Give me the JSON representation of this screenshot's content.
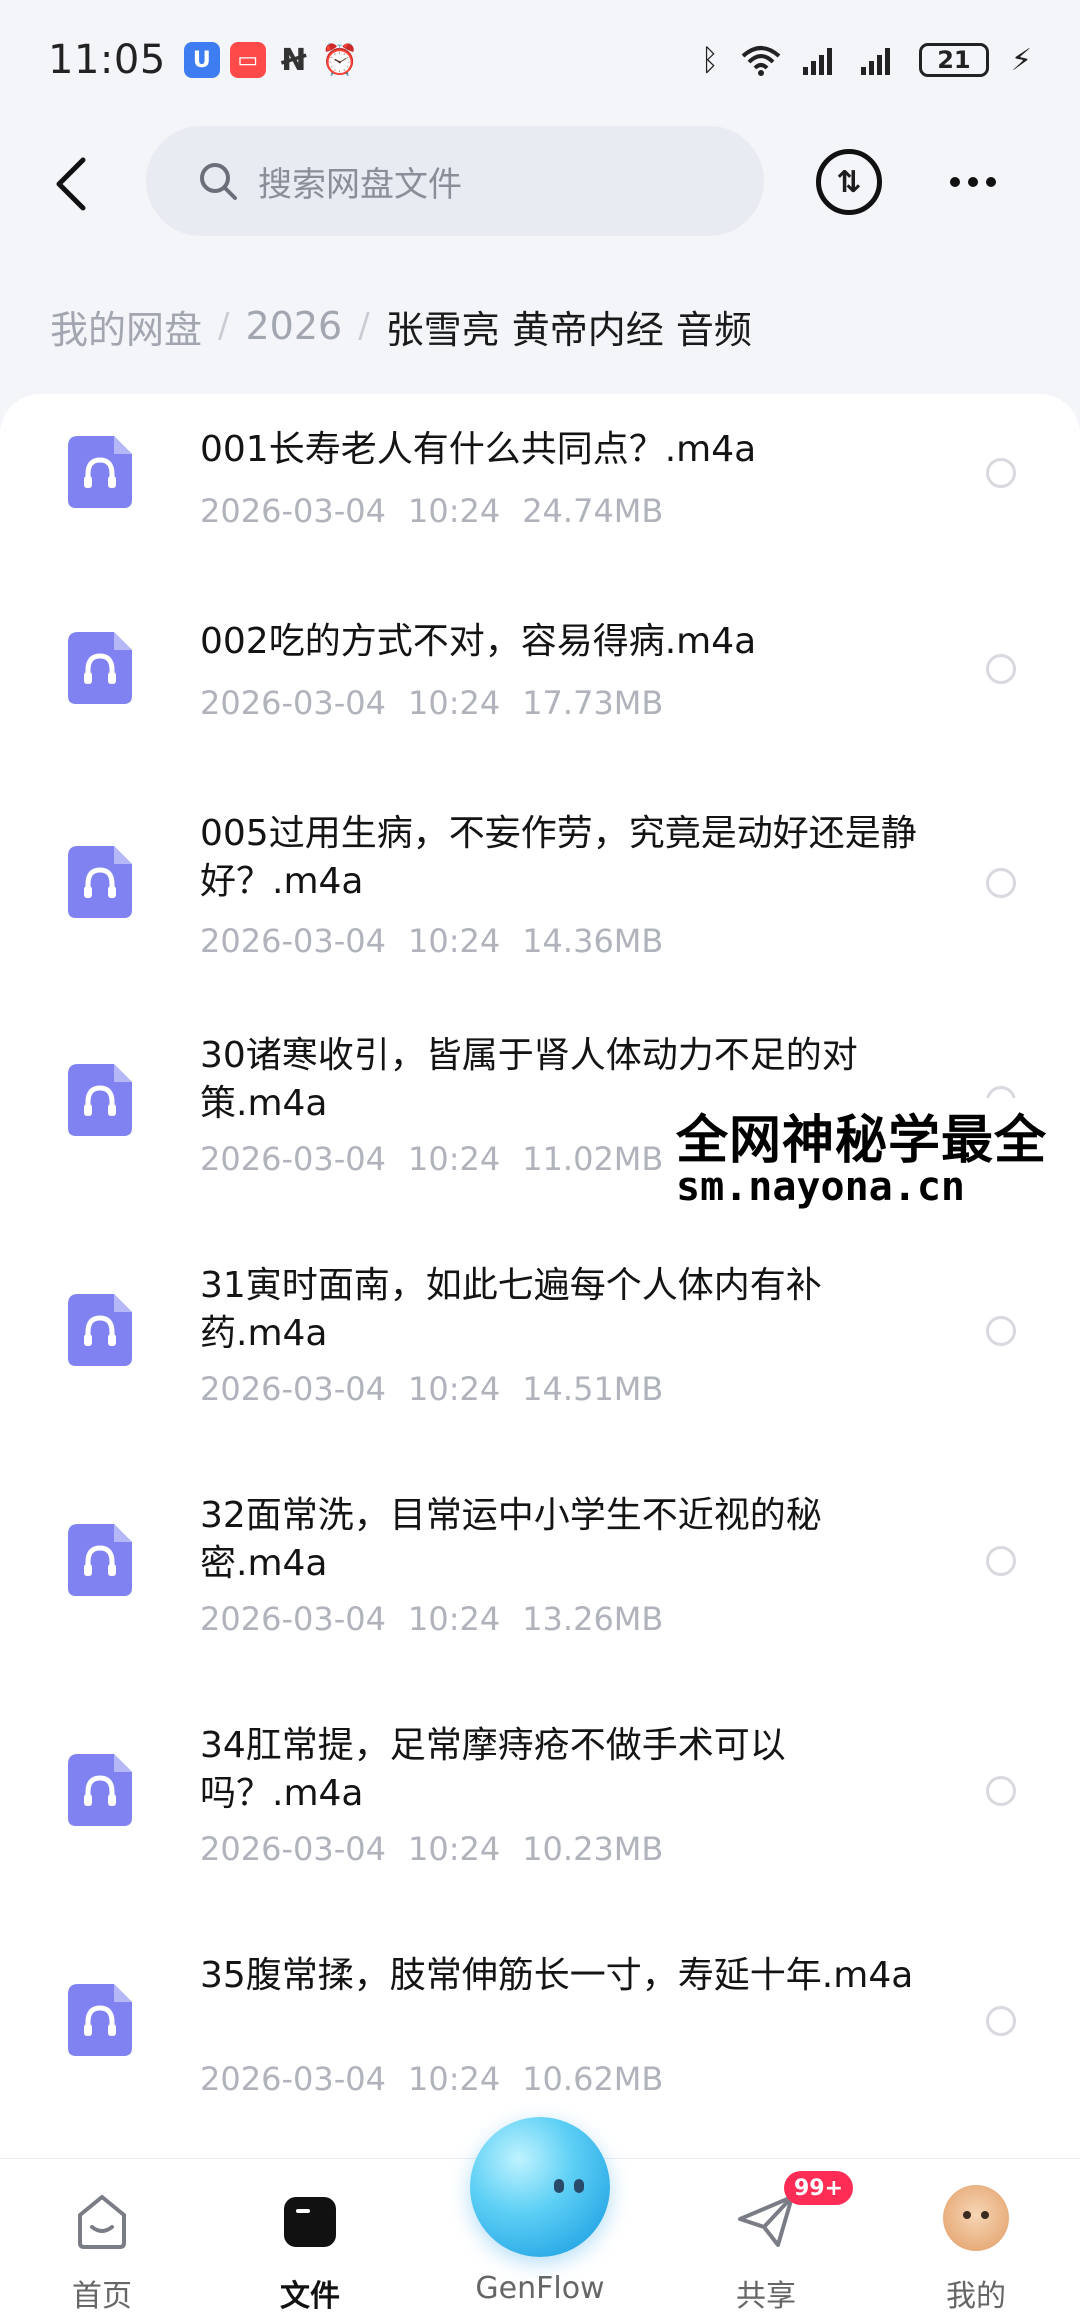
{
  "status_bar": {
    "time": "11:05",
    "battery": "21",
    "icons": [
      "app-icon-blue",
      "app-icon-red",
      "nfc-icon",
      "alarm-icon",
      "bluetooth-icon",
      "wifi-icon",
      "signal-icon",
      "signal-icon",
      "charging-icon"
    ]
  },
  "header": {
    "search_placeholder": "搜索网盘文件",
    "transfer_symbol": "⇅",
    "more": "more-icon"
  },
  "breadcrumb": {
    "items": [
      "我的网盘",
      "2026"
    ],
    "current": "张雪亮 黄帝内经 音频"
  },
  "files": [
    {
      "name": "001长寿老人有什么共同点？.m4a",
      "date": "2026-03-04",
      "time": "10:24",
      "size": "24.74MB"
    },
    {
      "name": "002吃的方式不对，容易得病.m4a",
      "date": "2026-03-04",
      "time": "10:24",
      "size": "17.73MB"
    },
    {
      "name": "005过用生病，不妄作劳，究竟是动好还是静好？.m4a",
      "date": "2026-03-04",
      "time": "10:24",
      "size": "14.36MB"
    },
    {
      "name": "30诸寒收引，皆属于肾人体动力不足的对策.m4a",
      "date": "2026-03-04",
      "time": "10:24",
      "size": "11.02MB"
    },
    {
      "name": "31寅时面南，如此七遍每个人体内有补药.m4a",
      "date": "2026-03-04",
      "time": "10:24",
      "size": "14.51MB"
    },
    {
      "name": "32面常洗，目常运中小学生不近视的秘密.m4a",
      "date": "2026-03-04",
      "time": "10:24",
      "size": "13.26MB"
    },
    {
      "name": "34肛常提，足常摩痔疮不做手术可以吗？.m4a",
      "date": "2026-03-04",
      "time": "10:24",
      "size": "10.23MB"
    },
    {
      "name": "35腹常揉，肢常伸筋长一寸，寿延十年.m4a",
      "date": "2026-03-04",
      "time": "10:24",
      "size": "10.62MB"
    }
  ],
  "watermark": {
    "line1": "全网神秘学最全",
    "line2": "sm.nayona.cn"
  },
  "bottom_nav": {
    "home": "首页",
    "files": "文件",
    "genflow": "GenFlow",
    "share": "共享",
    "share_badge": "99+",
    "me": "我的"
  },
  "colors": {
    "accent_icon": "#7f82f0",
    "badge": "#ff2d55"
  }
}
